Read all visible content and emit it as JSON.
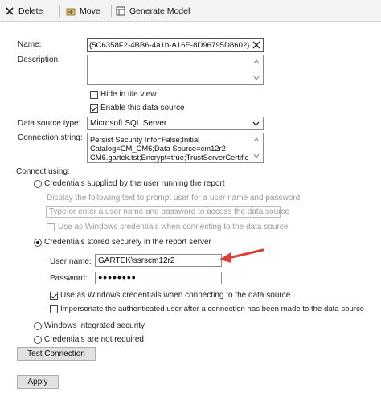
{
  "toolbar": {
    "delete_label": "Delete",
    "move_label": "Move",
    "generate_label": "Generate Model"
  },
  "form": {
    "name_label": "Name:",
    "name_value": "{5C6358F2-4BB6-4a1b-A16E-8D96795D8602}",
    "description_label": "Description:",
    "description_value": "",
    "hide_label": "Hide in tile view",
    "hide_checked": false,
    "enable_label": "Enable this data source",
    "enable_checked": true,
    "dstype_label": "Data source type:",
    "dstype_value": "Microsoft SQL Server",
    "connstr_label": "Connection string:",
    "connstr_lines": [
      "Persist Security Info=False;Initial",
      "Catalog=CM_CM6;Data Source=cm12r2-",
      "CM6.gartek.tst;Encrypt=true;TrustServerCertific"
    ]
  },
  "connect": {
    "heading": "Connect using:",
    "opt_supplied": "Credentials supplied by the user running the report",
    "prompt_label": "Display the following text to prompt user for a user name and password:",
    "prompt_value": "Type or enter a user name and password to access the data source",
    "use_windows_1": "Use as Windows credentials when connecting to the data source",
    "opt_stored": "Credentials stored securely in the report server",
    "username_label": "User name:",
    "username_value": "GARTEK\\ssrscm12r2",
    "password_label": "Password:",
    "password_value": "●●●●●●●●",
    "use_windows_2": "Use as Windows credentials when connecting to the data source",
    "impersonate": "Impersonate the authenticated user after a connection has been made to the data source",
    "opt_integrated": "Windows integrated security",
    "opt_none": "Credentials are not required",
    "selected": "stored"
  },
  "buttons": {
    "test_label": "Test Connection",
    "apply_label": "Apply"
  },
  "colors": {
    "arrow": "#d9403a"
  }
}
